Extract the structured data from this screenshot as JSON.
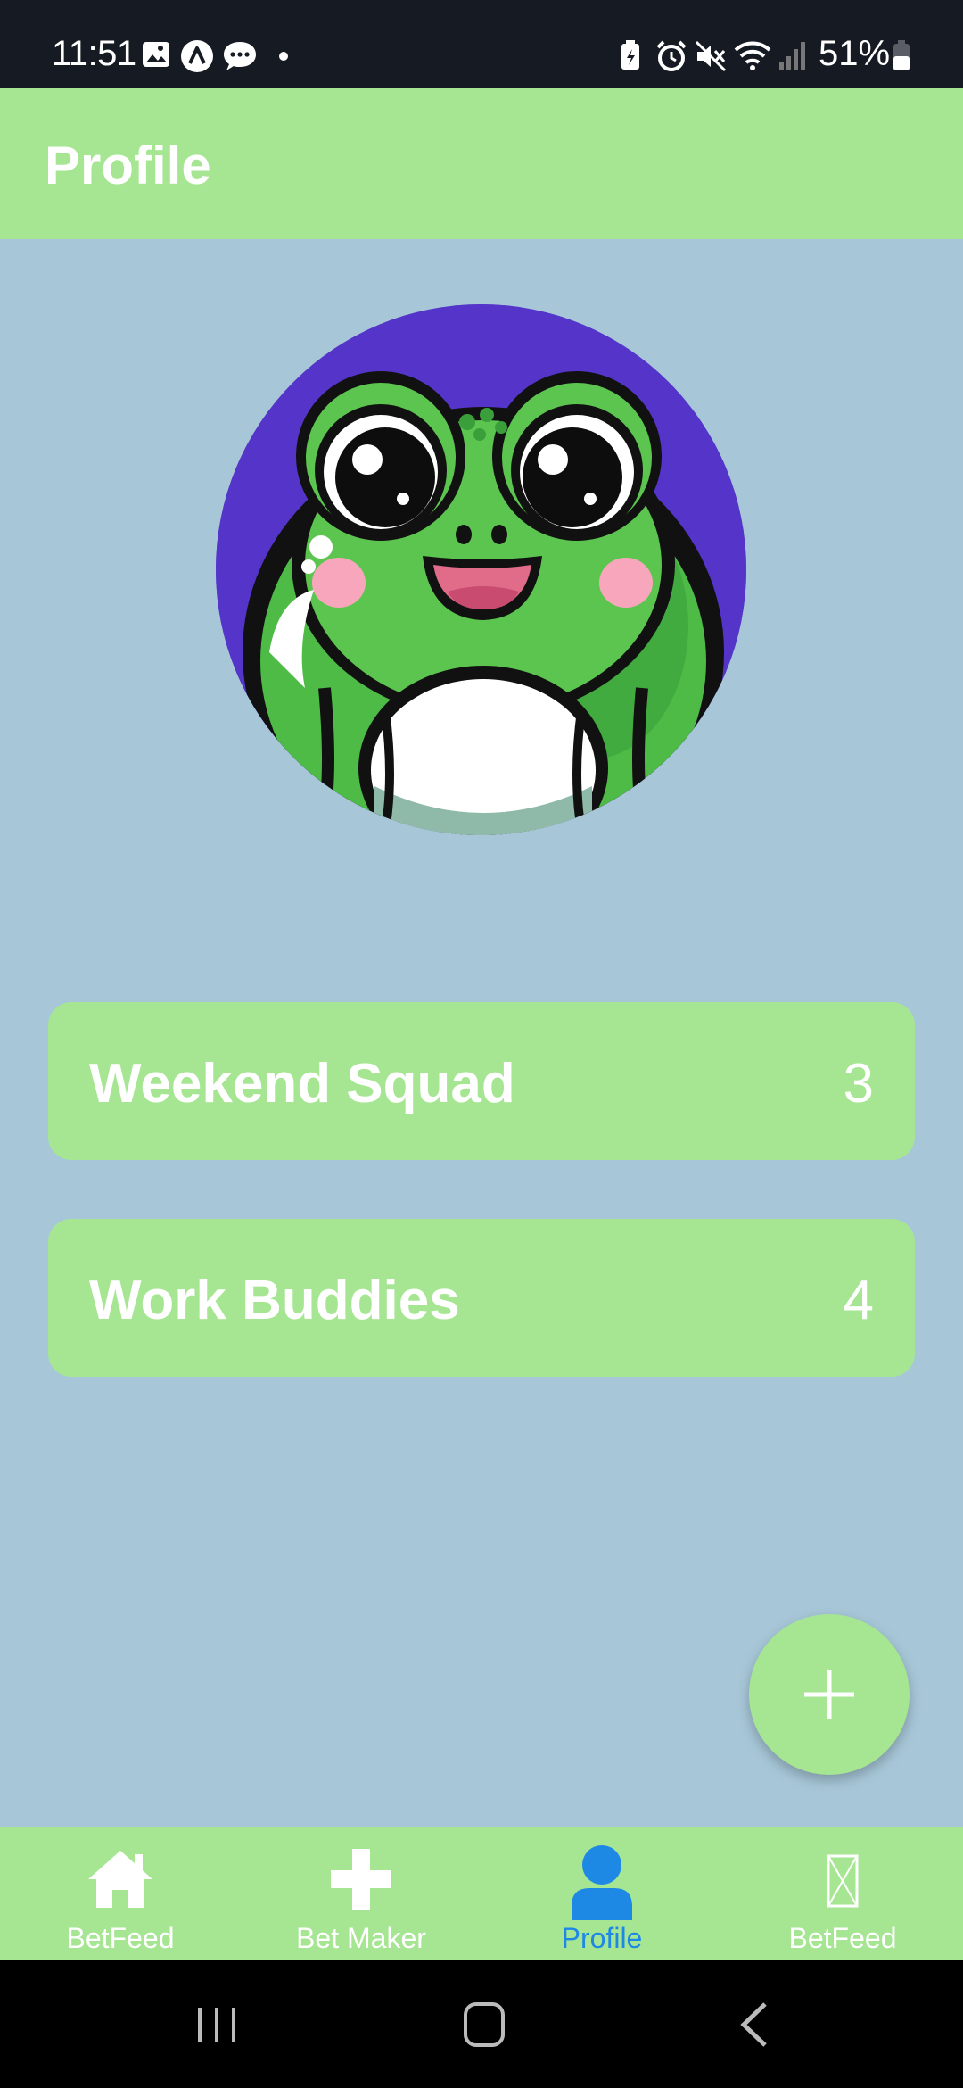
{
  "status_bar": {
    "time": "11:51",
    "battery_pct": "51%",
    "left_icons": [
      "image-icon",
      "app-a-icon",
      "chat-bubble-icon",
      "dot-icon"
    ],
    "right_icons": [
      "battery-saver-icon",
      "alarm-icon",
      "mute-icon",
      "wifi-icon",
      "signal-icon",
      "battery-icon"
    ]
  },
  "app_bar": {
    "title": "Profile"
  },
  "profile": {
    "avatar_icon": "frog-avatar"
  },
  "groups": [
    {
      "name": "Weekend Squad",
      "count": "3"
    },
    {
      "name": "Work Buddies",
      "count": "4"
    }
  ],
  "fab": {
    "icon": "plus-icon"
  },
  "bottom_nav": {
    "items": [
      {
        "label": "BetFeed",
        "icon": "home-icon"
      },
      {
        "label": "Bet Maker",
        "icon": "plus-cross-icon"
      },
      {
        "label": "Profile",
        "icon": "person-icon",
        "active": true
      },
      {
        "label": "BetFeed",
        "icon": "missing-icon"
      }
    ],
    "active_color": "#1e88e5"
  },
  "colors": {
    "accent_green": "#a6e693",
    "background": "#a7c7d8",
    "avatar_bg": "#5535c9",
    "status_bar": "#161a22"
  }
}
